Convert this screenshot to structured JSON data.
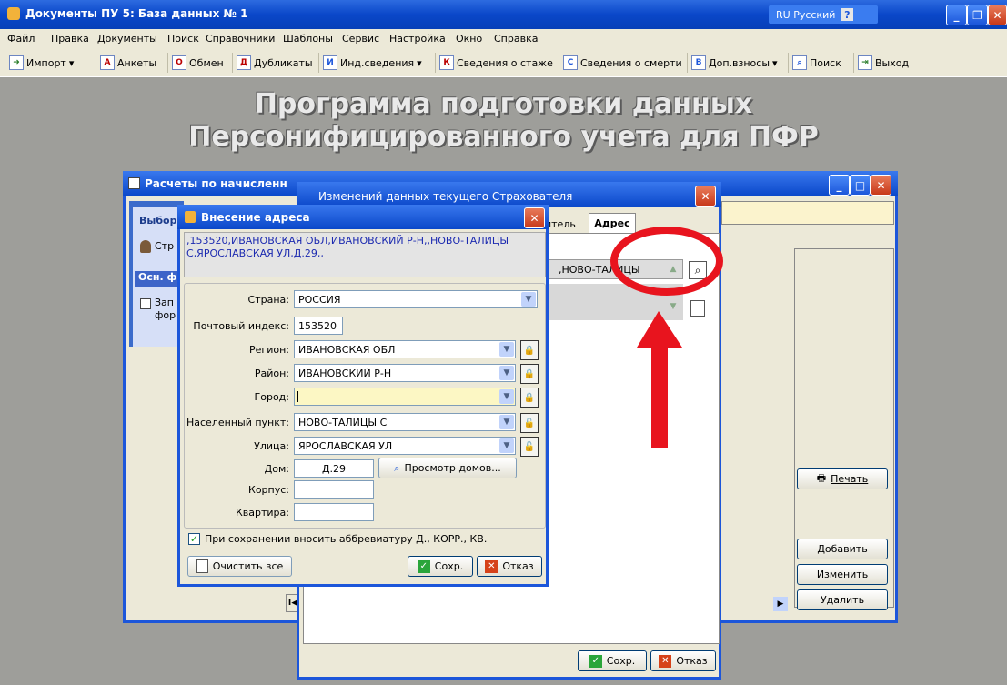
{
  "app": {
    "title": "Документы ПУ 5: База данных № 1",
    "lang": "RU Русский"
  },
  "menu": [
    "Файл",
    "Правка",
    "Документы",
    "Поиск",
    "Справочники",
    "Шаблоны",
    "Сервис",
    "Настройка",
    "Окно",
    "Справка"
  ],
  "toolbar": {
    "import": "Импорт",
    "ankety": "Анкеты",
    "obmen": "Обмен",
    "dublikaty": "Дубликаты",
    "ind": "Инд.сведения",
    "stazh": "Сведения о стаже",
    "smert": "Сведения о смерти",
    "dop": "Доп.взносы",
    "poisk": "Поиск",
    "vyhod": "Выход"
  },
  "banner": {
    "line1": "Программа подготовки данных",
    "line2": "Персонифицированного учета для ПФР"
  },
  "calc_window": {
    "title": "Расчеты по начисленн",
    "panel1": "Выбор",
    "panel1_item": "Стр",
    "panel2": "Осн. ф",
    "panel2_item1": "Зап",
    "panel2_item2": "фор",
    "print": "Печать",
    "add": "Добавить",
    "edit": "Изменить",
    "delete": "Удалить"
  },
  "change_window": {
    "title": "Изменений данных текущего Страхователя",
    "tab1": "итель",
    "tab2": "Адрес",
    "addr_partial": ",НОВО-ТАЛИЦЫ",
    "ok": "Сохр.",
    "cancel": "Отказ"
  },
  "addr_dialog": {
    "title": "Внесение адреса",
    "full_address": ",153520,ИВАНОВСКАЯ ОБЛ,ИВАНОВСКИЙ Р-Н,,НОВО-ТАЛИЦЫ С,ЯРОСЛАВСКАЯ УЛ,Д.29,,",
    "country_label": "Страна:",
    "country": "РОССИЯ",
    "index_label": "Почтовый индекс:",
    "index": "153520",
    "region_label": "Регион:",
    "region": "ИВАНОВСКАЯ ОБЛ",
    "district_label": "Район:",
    "district": "ИВАНОВСКИЙ Р-Н",
    "city_label": "Город:",
    "city": "",
    "settlement_label": "Населенный пункт:",
    "settlement": "НОВО-ТАЛИЦЫ С",
    "street_label": "Улица:",
    "street": "ЯРОСЛАВСКАЯ УЛ",
    "house_label": "Дом:",
    "house": "Д.29",
    "houses_btn": "Просмотр домов...",
    "building_label": "Корпус:",
    "building": "",
    "flat_label": "Квартира:",
    "flat": "",
    "abbr_checkbox": "При сохранении вносить аббревиатуру Д., КОРР., КВ.",
    "clear": "Очистить все",
    "ok": "Сохр.",
    "cancel": "Отказ"
  },
  "colors": {
    "annotation": "#e8141e",
    "xp_blue": "#0a47c9",
    "desk": "#9e9e9a",
    "city_highlight": "#fcf7c4"
  }
}
